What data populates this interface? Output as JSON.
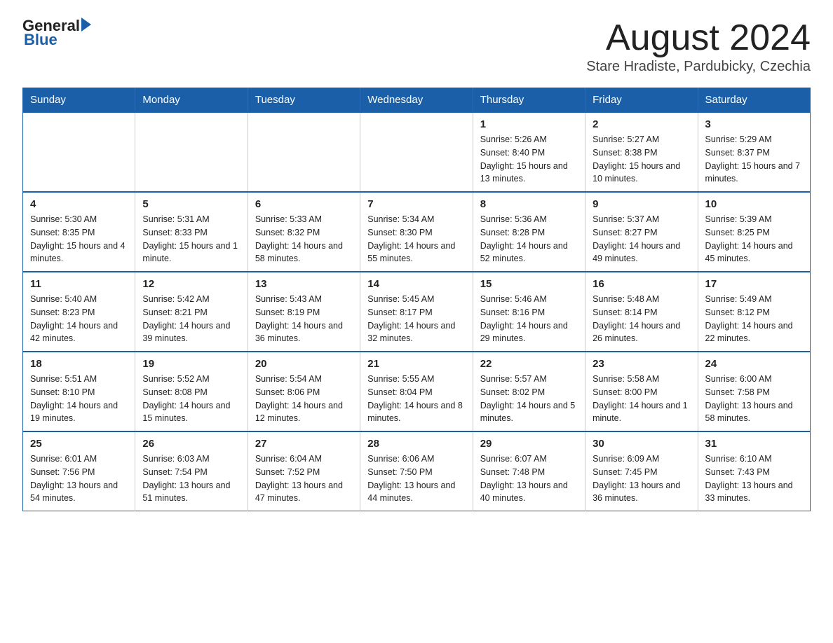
{
  "logo": {
    "general": "General",
    "arrow": "",
    "blue": "Blue"
  },
  "title": "August 2024",
  "subtitle": "Stare Hradiste, Pardubicky, Czechia",
  "days_header": [
    "Sunday",
    "Monday",
    "Tuesday",
    "Wednesday",
    "Thursday",
    "Friday",
    "Saturday"
  ],
  "weeks": [
    [
      {
        "day": "",
        "info": ""
      },
      {
        "day": "",
        "info": ""
      },
      {
        "day": "",
        "info": ""
      },
      {
        "day": "",
        "info": ""
      },
      {
        "day": "1",
        "info": "Sunrise: 5:26 AM\nSunset: 8:40 PM\nDaylight: 15 hours and 13 minutes."
      },
      {
        "day": "2",
        "info": "Sunrise: 5:27 AM\nSunset: 8:38 PM\nDaylight: 15 hours and 10 minutes."
      },
      {
        "day": "3",
        "info": "Sunrise: 5:29 AM\nSunset: 8:37 PM\nDaylight: 15 hours and 7 minutes."
      }
    ],
    [
      {
        "day": "4",
        "info": "Sunrise: 5:30 AM\nSunset: 8:35 PM\nDaylight: 15 hours and 4 minutes."
      },
      {
        "day": "5",
        "info": "Sunrise: 5:31 AM\nSunset: 8:33 PM\nDaylight: 15 hours and 1 minute."
      },
      {
        "day": "6",
        "info": "Sunrise: 5:33 AM\nSunset: 8:32 PM\nDaylight: 14 hours and 58 minutes."
      },
      {
        "day": "7",
        "info": "Sunrise: 5:34 AM\nSunset: 8:30 PM\nDaylight: 14 hours and 55 minutes."
      },
      {
        "day": "8",
        "info": "Sunrise: 5:36 AM\nSunset: 8:28 PM\nDaylight: 14 hours and 52 minutes."
      },
      {
        "day": "9",
        "info": "Sunrise: 5:37 AM\nSunset: 8:27 PM\nDaylight: 14 hours and 49 minutes."
      },
      {
        "day": "10",
        "info": "Sunrise: 5:39 AM\nSunset: 8:25 PM\nDaylight: 14 hours and 45 minutes."
      }
    ],
    [
      {
        "day": "11",
        "info": "Sunrise: 5:40 AM\nSunset: 8:23 PM\nDaylight: 14 hours and 42 minutes."
      },
      {
        "day": "12",
        "info": "Sunrise: 5:42 AM\nSunset: 8:21 PM\nDaylight: 14 hours and 39 minutes."
      },
      {
        "day": "13",
        "info": "Sunrise: 5:43 AM\nSunset: 8:19 PM\nDaylight: 14 hours and 36 minutes."
      },
      {
        "day": "14",
        "info": "Sunrise: 5:45 AM\nSunset: 8:17 PM\nDaylight: 14 hours and 32 minutes."
      },
      {
        "day": "15",
        "info": "Sunrise: 5:46 AM\nSunset: 8:16 PM\nDaylight: 14 hours and 29 minutes."
      },
      {
        "day": "16",
        "info": "Sunrise: 5:48 AM\nSunset: 8:14 PM\nDaylight: 14 hours and 26 minutes."
      },
      {
        "day": "17",
        "info": "Sunrise: 5:49 AM\nSunset: 8:12 PM\nDaylight: 14 hours and 22 minutes."
      }
    ],
    [
      {
        "day": "18",
        "info": "Sunrise: 5:51 AM\nSunset: 8:10 PM\nDaylight: 14 hours and 19 minutes."
      },
      {
        "day": "19",
        "info": "Sunrise: 5:52 AM\nSunset: 8:08 PM\nDaylight: 14 hours and 15 minutes."
      },
      {
        "day": "20",
        "info": "Sunrise: 5:54 AM\nSunset: 8:06 PM\nDaylight: 14 hours and 12 minutes."
      },
      {
        "day": "21",
        "info": "Sunrise: 5:55 AM\nSunset: 8:04 PM\nDaylight: 14 hours and 8 minutes."
      },
      {
        "day": "22",
        "info": "Sunrise: 5:57 AM\nSunset: 8:02 PM\nDaylight: 14 hours and 5 minutes."
      },
      {
        "day": "23",
        "info": "Sunrise: 5:58 AM\nSunset: 8:00 PM\nDaylight: 14 hours and 1 minute."
      },
      {
        "day": "24",
        "info": "Sunrise: 6:00 AM\nSunset: 7:58 PM\nDaylight: 13 hours and 58 minutes."
      }
    ],
    [
      {
        "day": "25",
        "info": "Sunrise: 6:01 AM\nSunset: 7:56 PM\nDaylight: 13 hours and 54 minutes."
      },
      {
        "day": "26",
        "info": "Sunrise: 6:03 AM\nSunset: 7:54 PM\nDaylight: 13 hours and 51 minutes."
      },
      {
        "day": "27",
        "info": "Sunrise: 6:04 AM\nSunset: 7:52 PM\nDaylight: 13 hours and 47 minutes."
      },
      {
        "day": "28",
        "info": "Sunrise: 6:06 AM\nSunset: 7:50 PM\nDaylight: 13 hours and 44 minutes."
      },
      {
        "day": "29",
        "info": "Sunrise: 6:07 AM\nSunset: 7:48 PM\nDaylight: 13 hours and 40 minutes."
      },
      {
        "day": "30",
        "info": "Sunrise: 6:09 AM\nSunset: 7:45 PM\nDaylight: 13 hours and 36 minutes."
      },
      {
        "day": "31",
        "info": "Sunrise: 6:10 AM\nSunset: 7:43 PM\nDaylight: 13 hours and 33 minutes."
      }
    ]
  ]
}
